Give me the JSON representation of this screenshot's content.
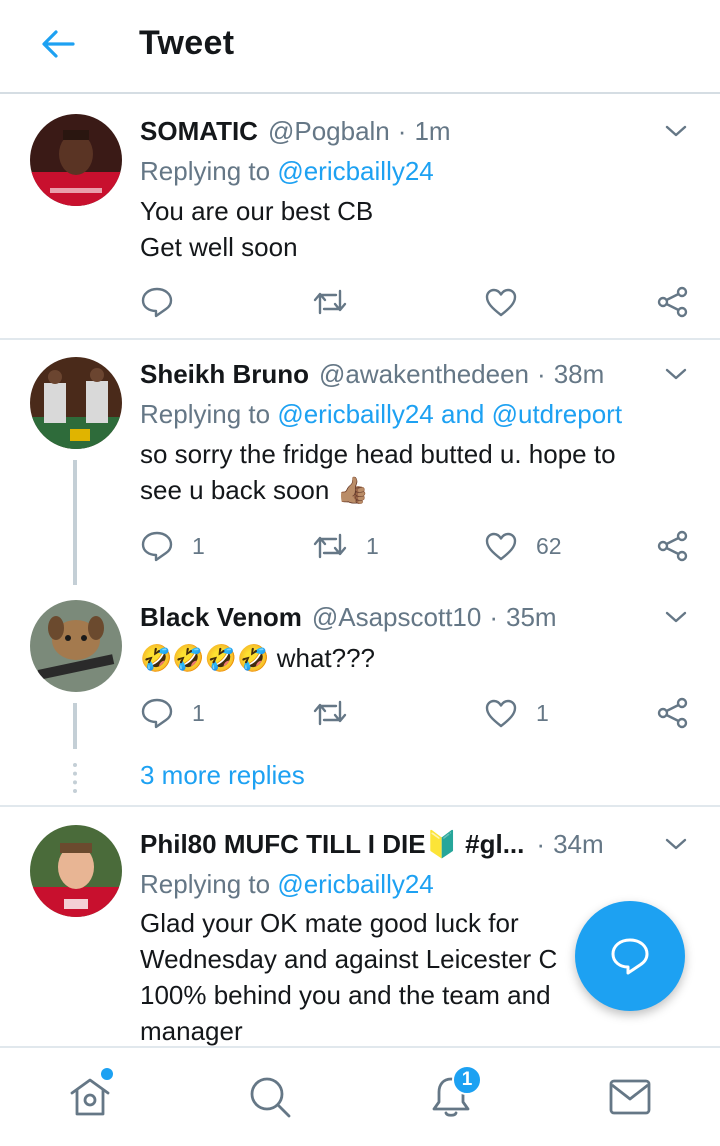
{
  "header": {
    "title": "Tweet"
  },
  "tweets": [
    {
      "name": "SOMATIC",
      "handle": "@Pogbaln",
      "dot": "·",
      "time": "1m",
      "replying_label": "Replying to",
      "replying_users": "@ericbailly24",
      "body": [
        "You are our best CB",
        "Get well soon"
      ],
      "reply_count": "",
      "retweet_count": "",
      "like_count": ""
    },
    {
      "name": "Sheikh Bruno",
      "handle": "@awakenthedeen",
      "dot": "·",
      "time": "38m",
      "replying_label": "Replying to",
      "replying_users": "@ericbailly24 and @utdreport",
      "body": [
        "so sorry the fridge head butted u. hope to",
        "see u back soon 👍🏽"
      ],
      "reply_count": "1",
      "retweet_count": "1",
      "like_count": "62"
    },
    {
      "name": "Black Venom",
      "handle": "@Asapscott10",
      "dot": "·",
      "time": "35m",
      "body": [
        "🤣🤣🤣🤣 what???"
      ],
      "reply_count": "1",
      "retweet_count": "",
      "like_count": "1"
    },
    {
      "name": "Phil80 MUFC TILL I DIE🔰 #gl...",
      "dot": "·",
      "time": "34m",
      "replying_label": "Replying to",
      "replying_users": "@ericbailly24",
      "body": [
        "Glad your OK mate good luck for",
        "Wednesday and against Leicester C",
        "100% behind you and the team and",
        "manager"
      ]
    }
  ],
  "more_replies": "3 more replies",
  "nav": {
    "notification_badge": "1"
  },
  "icons": {
    "back": "arrow-left-icon",
    "chevron": "chevron-down-icon",
    "reply": "reply-icon",
    "retweet": "retweet-icon",
    "like": "heart-icon",
    "share": "share-icon",
    "compose": "compose-reply-icon",
    "home": "home-icon",
    "search": "search-icon",
    "notifications": "bell-icon",
    "messages": "mail-icon"
  },
  "colors": {
    "accent": "#1da1f2",
    "muted": "#657786",
    "text": "#14171a",
    "divider": "#e1e8ed"
  }
}
